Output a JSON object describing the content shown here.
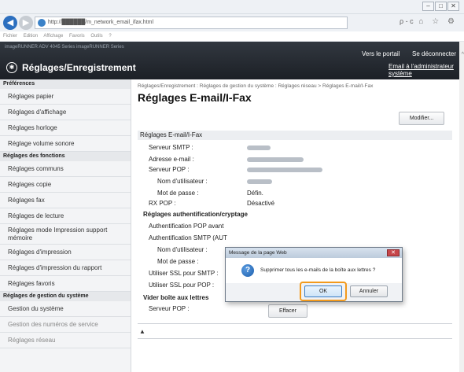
{
  "browser": {
    "window_buttons": [
      "–",
      "□",
      "✕"
    ],
    "url": "http://██████/m_network_email_ifax.html",
    "address_tools": "ρ - c",
    "tool_icons": "⌂ ☆ ⚙",
    "menu": [
      "Fichier",
      "Edition",
      "Affichage",
      "Favoris",
      "Outils",
      "?"
    ]
  },
  "header": {
    "device_info": "imageRUNNER ADV 4045  Series  imageRUNNER  Series",
    "title": "Réglages/Enregistrement",
    "portal_link": "Vers le portail",
    "logout_link": "Se déconnecter",
    "admin_link": "Email à l'administrateur système"
  },
  "sidebar": {
    "sections": [
      {
        "title": "Préférences",
        "items": [
          "Réglages papier",
          "Réglages d'affichage",
          "Réglages horloge",
          "Réglage volume sonore"
        ]
      },
      {
        "title": "Réglages des fonctions",
        "items": [
          "Réglages communs",
          "Réglages copie",
          "Réglages fax",
          "Réglages de lecture",
          "Réglages mode Impression support mémoire",
          "Réglages d'impression",
          "Réglages d'impression du rapport",
          "Réglages favoris"
        ]
      },
      {
        "title": "Réglages de gestion du système",
        "items": [
          "Gestion du système",
          "Gestion des numéros de service",
          "Réglages réseau"
        ]
      }
    ]
  },
  "main": {
    "breadcrumb": "Réglages/Enregistrement : Réglages de gestion du système : Réglages réseau > Réglages E-mail/I-Fax",
    "title": "Réglages E-mail/I-Fax",
    "modify_label": "Modifier...",
    "section_title": "Réglages E-mail/I-Fax",
    "fields": {
      "smtp_server": "Serveur SMTP :",
      "email_address": "Adresse e-mail :",
      "pop_server": "Serveur POP :",
      "username": "Nom d'utilisateur :",
      "password": "Mot de passe :",
      "password_value": "Défin.",
      "rx_pop": "RX POP :",
      "rx_pop_value": "Désactivé"
    },
    "auth_section": "Réglages authentification/cryptage",
    "auth_fields": {
      "pop_auth": "Authentification POP avant",
      "smtp_auth": "Authentification SMTP (AUT",
      "username": "Nom d'utilisateur :",
      "password": "Mot de passe :",
      "ssl_smtp": "Utiliser SSL pour SMTP :",
      "ssl_pop": "Utiliser SSL pour POP :"
    },
    "clear_section": "Vider boîte aux lettres",
    "clear_pop_server": "Serveur POP :",
    "clear_label": "Effacer",
    "top_icon": "▲"
  },
  "dialog": {
    "title": "Message de la page Web",
    "close_label": "✕",
    "message": "Supprimer tous les e-mails de la boîte aux lettres ?",
    "ok_label": "OK",
    "cancel_label": "Annuler",
    "icon": "?"
  }
}
